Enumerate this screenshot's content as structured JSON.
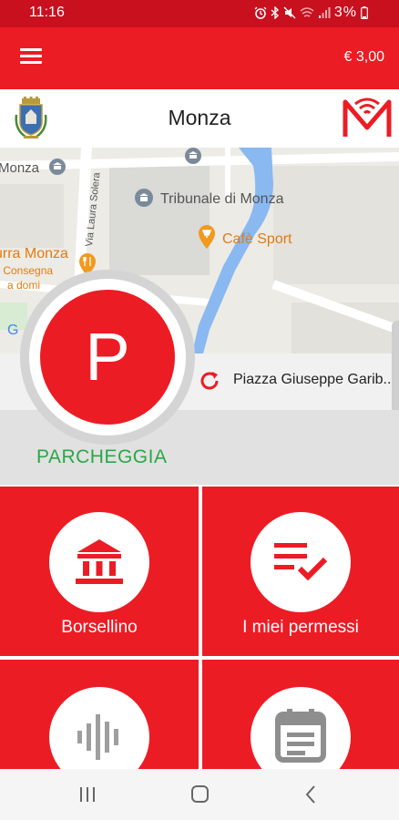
{
  "status_bar": {
    "time": "11:16",
    "icons": [
      "alarm-icon",
      "bluetooth-icon",
      "mute-icon",
      "wifi-icon",
      "signal-icon"
    ],
    "battery": "3%"
  },
  "app_bar": {
    "balance": "€ 3,00"
  },
  "city": {
    "name": "Monza"
  },
  "map": {
    "labels": {
      "monza": "Monza",
      "tribunale": "Tribunale di Monza",
      "cafe": "Cafè Sport",
      "street": "Via Laura Solera",
      "birra_line1": "urra Monza",
      "birra_line2": "- Consegna",
      "birra_line3": "a domi",
      "google_letter": "G"
    },
    "address": "Piazza Giuseppe Garib..."
  },
  "parking": {
    "button_letter": "P",
    "label": "PARCHEGGIA"
  },
  "tiles": [
    {
      "label": "Borsellino",
      "icon": "bank-icon"
    },
    {
      "label": "I miei permessi",
      "icon": "checklist-icon"
    },
    {
      "label": "",
      "icon": "audio-waveform-icon"
    },
    {
      "label": "",
      "icon": "calendar-icon"
    }
  ],
  "colors": {
    "brand_red": "#ec1c24",
    "status_red": "#c8101e",
    "park_green": "#2aa748"
  },
  "nav_bar": {
    "buttons": [
      "recent-apps-icon",
      "home-icon",
      "back-icon"
    ]
  }
}
